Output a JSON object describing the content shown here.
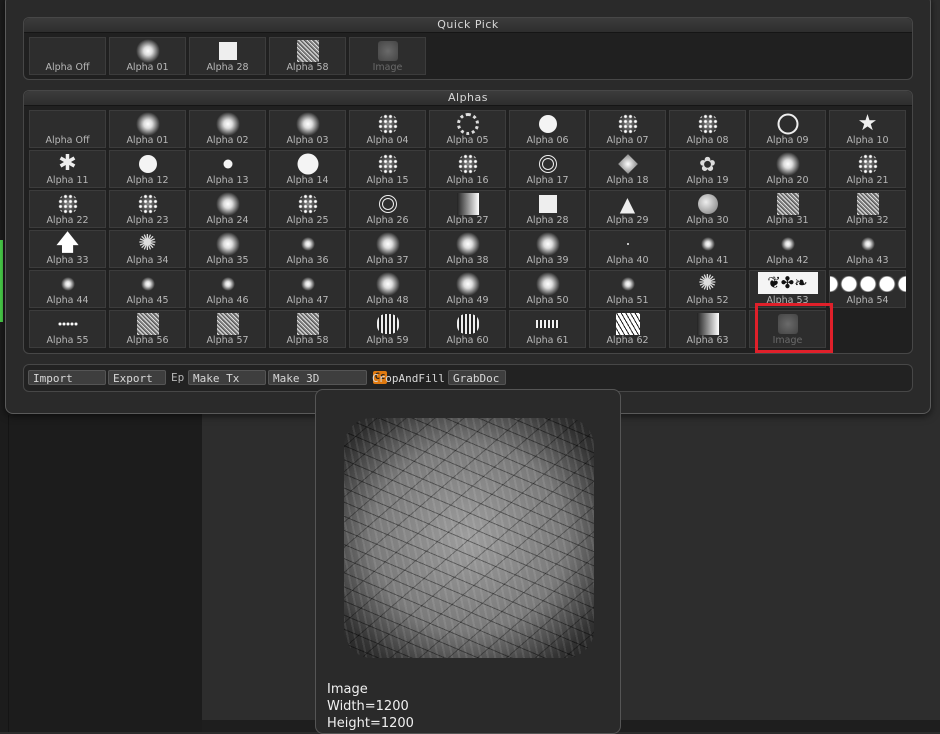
{
  "quick_pick": {
    "title": "Quick Pick",
    "items": [
      {
        "label": "Alpha Off",
        "icon": "none"
      },
      {
        "label": "Alpha 01",
        "icon": "soft"
      },
      {
        "label": "Alpha 28",
        "icon": "square"
      },
      {
        "label": "Alpha 58",
        "icon": "noise"
      },
      {
        "label": "Image",
        "icon": "image",
        "dim": true
      }
    ]
  },
  "alphas": {
    "title": "Alphas",
    "items": [
      {
        "label": "Alpha Off",
        "icon": "none"
      },
      {
        "label": "Alpha 01",
        "icon": "soft"
      },
      {
        "label": "Alpha 02",
        "icon": "soft"
      },
      {
        "label": "Alpha 03",
        "icon": "soft"
      },
      {
        "label": "Alpha 04",
        "icon": "speckle"
      },
      {
        "label": "Alpha 05",
        "icon": "ring-dots"
      },
      {
        "label": "Alpha 06",
        "icon": "hard"
      },
      {
        "label": "Alpha 07",
        "icon": "speckle"
      },
      {
        "label": "Alpha 08",
        "icon": "speckle"
      },
      {
        "label": "Alpha 09",
        "icon": "ring"
      },
      {
        "label": "Alpha 10",
        "icon": "star"
      },
      {
        "label": "Alpha 11",
        "icon": "asterisk"
      },
      {
        "label": "Alpha 12",
        "icon": "hard"
      },
      {
        "label": "Alpha 13",
        "icon": "hard-small"
      },
      {
        "label": "Alpha 14",
        "icon": "hard-big"
      },
      {
        "label": "Alpha 15",
        "icon": "speckle"
      },
      {
        "label": "Alpha 16",
        "icon": "speckle"
      },
      {
        "label": "Alpha 17",
        "icon": "target"
      },
      {
        "label": "Alpha 18",
        "icon": "diamond"
      },
      {
        "label": "Alpha 19",
        "icon": "swirl"
      },
      {
        "label": "Alpha 20",
        "icon": "soft"
      },
      {
        "label": "Alpha 21",
        "icon": "speckle"
      },
      {
        "label": "Alpha 22",
        "icon": "speckle"
      },
      {
        "label": "Alpha 23",
        "icon": "speckle"
      },
      {
        "label": "Alpha 24",
        "icon": "soft"
      },
      {
        "label": "Alpha 25",
        "icon": "speckle"
      },
      {
        "label": "Alpha 26",
        "icon": "target"
      },
      {
        "label": "Alpha 27",
        "icon": "gradient"
      },
      {
        "label": "Alpha 28",
        "icon": "square"
      },
      {
        "label": "Alpha 29",
        "icon": "tree"
      },
      {
        "label": "Alpha 30",
        "icon": "ball"
      },
      {
        "label": "Alpha 31",
        "icon": "noise"
      },
      {
        "label": "Alpha 32",
        "icon": "noise"
      },
      {
        "label": "Alpha 33",
        "icon": "arrow"
      },
      {
        "label": "Alpha 34",
        "icon": "burst"
      },
      {
        "label": "Alpha 35",
        "icon": "soft"
      },
      {
        "label": "Alpha 36",
        "icon": "soft-small"
      },
      {
        "label": "Alpha 37",
        "icon": "soft"
      },
      {
        "label": "Alpha 38",
        "icon": "soft"
      },
      {
        "label": "Alpha 39",
        "icon": "soft"
      },
      {
        "label": "Alpha 40",
        "icon": "dot"
      },
      {
        "label": "Alpha 41",
        "icon": "soft-small"
      },
      {
        "label": "Alpha 42",
        "icon": "soft-small"
      },
      {
        "label": "Alpha 43",
        "icon": "soft-small"
      },
      {
        "label": "Alpha 44",
        "icon": "soft-small"
      },
      {
        "label": "Alpha 45",
        "icon": "soft-small"
      },
      {
        "label": "Alpha 46",
        "icon": "soft-small"
      },
      {
        "label": "Alpha 47",
        "icon": "soft-small"
      },
      {
        "label": "Alpha 48",
        "icon": "soft"
      },
      {
        "label": "Alpha 49",
        "icon": "soft"
      },
      {
        "label": "Alpha 50",
        "icon": "soft"
      },
      {
        "label": "Alpha 51",
        "icon": "soft-small"
      },
      {
        "label": "Alpha 52",
        "icon": "burst"
      },
      {
        "label": "Alpha 53",
        "icon": "ornament"
      },
      {
        "label": "Alpha 54",
        "icon": "dots-row"
      },
      {
        "label": "Alpha 55",
        "icon": "dots-line"
      },
      {
        "label": "Alpha 56",
        "icon": "noise"
      },
      {
        "label": "Alpha 57",
        "icon": "noise"
      },
      {
        "label": "Alpha 58",
        "icon": "noise"
      },
      {
        "label": "Alpha 59",
        "icon": "bars"
      },
      {
        "label": "Alpha 60",
        "icon": "bars"
      },
      {
        "label": "Alpha 61",
        "icon": "bars-small"
      },
      {
        "label": "Alpha 62",
        "icon": "cells"
      },
      {
        "label": "Alpha 63",
        "icon": "gradient"
      },
      {
        "label": "Image",
        "icon": "image",
        "dim": true,
        "selected": true
      }
    ]
  },
  "toolbar": {
    "import": "Import",
    "export": "Export",
    "ep": "Ep",
    "make_tx": "Make Tx",
    "make_3d": "Make 3D",
    "cc": "Cc",
    "crop_and_fill": "CropAndFill",
    "grab_doc": "GrabDoc"
  },
  "preview": {
    "name": "Image",
    "width_text": "Width=1200",
    "height_text": "Height=1200"
  },
  "colors": {
    "accent": "#e07a10",
    "highlight": "#e0202a"
  }
}
